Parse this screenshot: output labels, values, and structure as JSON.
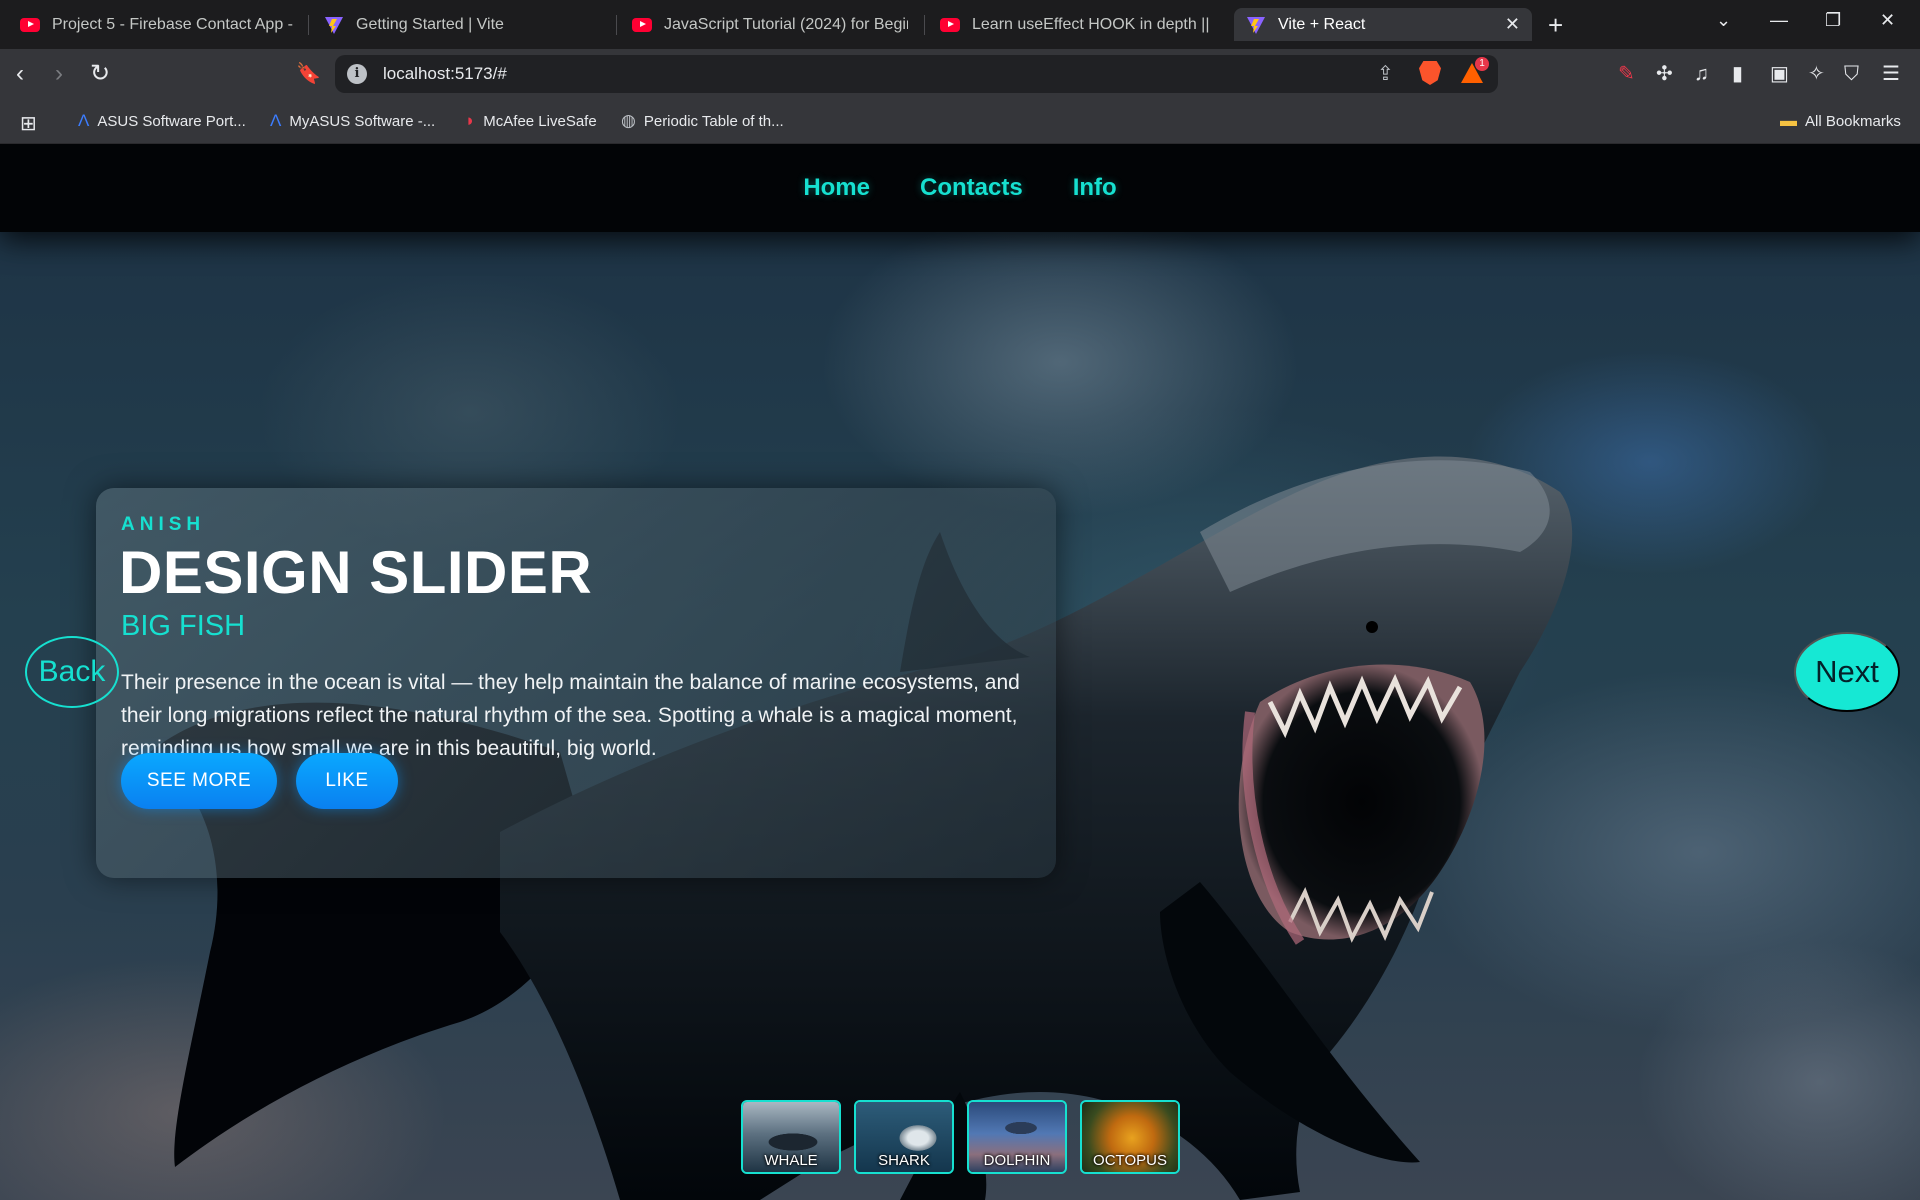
{
  "browser": {
    "tabs": [
      {
        "title": "Project 5 - Firebase Contact App - CR",
        "icon": "youtube-icon",
        "active": false
      },
      {
        "title": "Getting Started | Vite",
        "icon": "vite-icon",
        "active": false
      },
      {
        "title": "JavaScript Tutorial (2024) for Beginne",
        "icon": "youtube-icon",
        "active": false
      },
      {
        "title": "Learn useEffect HOOK in depth || Cor",
        "icon": "youtube-icon",
        "active": false
      },
      {
        "title": "Vite + React",
        "icon": "vite-icon",
        "active": true
      }
    ],
    "url": "localhost:5173/#",
    "rewards_badge": "1",
    "bookmarks": [
      {
        "label": "ASUS Software Port...",
        "icon": "asus-icon"
      },
      {
        "label": "MyASUS Software -...",
        "icon": "asus-icon"
      },
      {
        "label": "McAfee LiveSafe",
        "icon": "mcafee-icon"
      },
      {
        "label": "Periodic Table of th...",
        "icon": "globe-icon"
      }
    ],
    "all_bookmarks": "All Bookmarks"
  },
  "page": {
    "nav": [
      "Home",
      "Contacts",
      "Info"
    ],
    "slide": {
      "author": "ANISH",
      "title": "DESIGN SLIDER",
      "topic": "BIG FISH",
      "description": "Their presence in the ocean is vital — they help maintain the balance of marine ecosystems, and their long migrations reflect the natural rhythm of the sea. Spotting a whale is a magical moment, reminding us how small we are in this beautiful, big world.",
      "buttons": {
        "see_more": "SEE MORE",
        "like": "LIKE"
      }
    },
    "arrows": {
      "back": "Back",
      "next": "Next"
    },
    "thumbnails": [
      "WHALE",
      "SHARK",
      "DOLPHIN",
      "OCTOPUS"
    ],
    "colors": {
      "accent": "#16e0d0",
      "button_blue": "#0a9cff",
      "navbar_bg": "#020406"
    }
  }
}
